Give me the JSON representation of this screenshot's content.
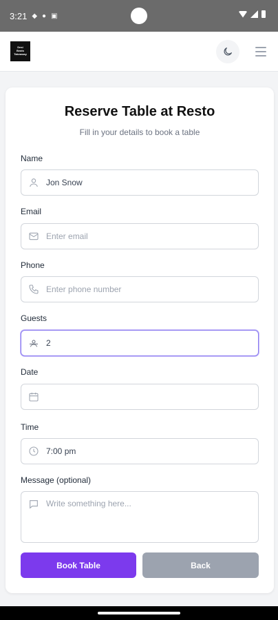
{
  "status_bar": {
    "time": "3:21",
    "icons": [
      "shield-icon",
      "mic-icon",
      "app-icon",
      "wifi-icon",
      "signal-icon",
      "battery-icon"
    ]
  },
  "header": {
    "logo_lines": [
      "Desi",
      "Beats",
      "Takeaway"
    ],
    "icons": [
      "moon-icon",
      "menu-icon"
    ]
  },
  "form": {
    "title": "Reserve Table at Resto",
    "subtitle": "Fill in your details to book a table",
    "fields": {
      "name": {
        "label": "Name",
        "value": "Jon Snow",
        "icon": "user-icon"
      },
      "email": {
        "label": "Email",
        "placeholder": "Enter email",
        "icon": "mail-icon"
      },
      "phone": {
        "label": "Phone",
        "placeholder": "Enter phone number",
        "icon": "phone-icon"
      },
      "guests": {
        "label": "Guests",
        "value": "2",
        "icon": "guests-icon"
      },
      "date": {
        "label": "Date",
        "value": "",
        "icon": "calendar-icon"
      },
      "time": {
        "label": "Time",
        "value": "7:00 pm",
        "icon": "clock-icon"
      },
      "message": {
        "label": "Message (optional)",
        "placeholder": "Write something here...",
        "icon": "message-icon"
      }
    },
    "buttons": {
      "book": "Book Table",
      "back": "Back"
    }
  },
  "colors": {
    "accent": "#7c3aed",
    "secondary_button": "#9ca3af",
    "focus_border": "#8b7cf0"
  }
}
